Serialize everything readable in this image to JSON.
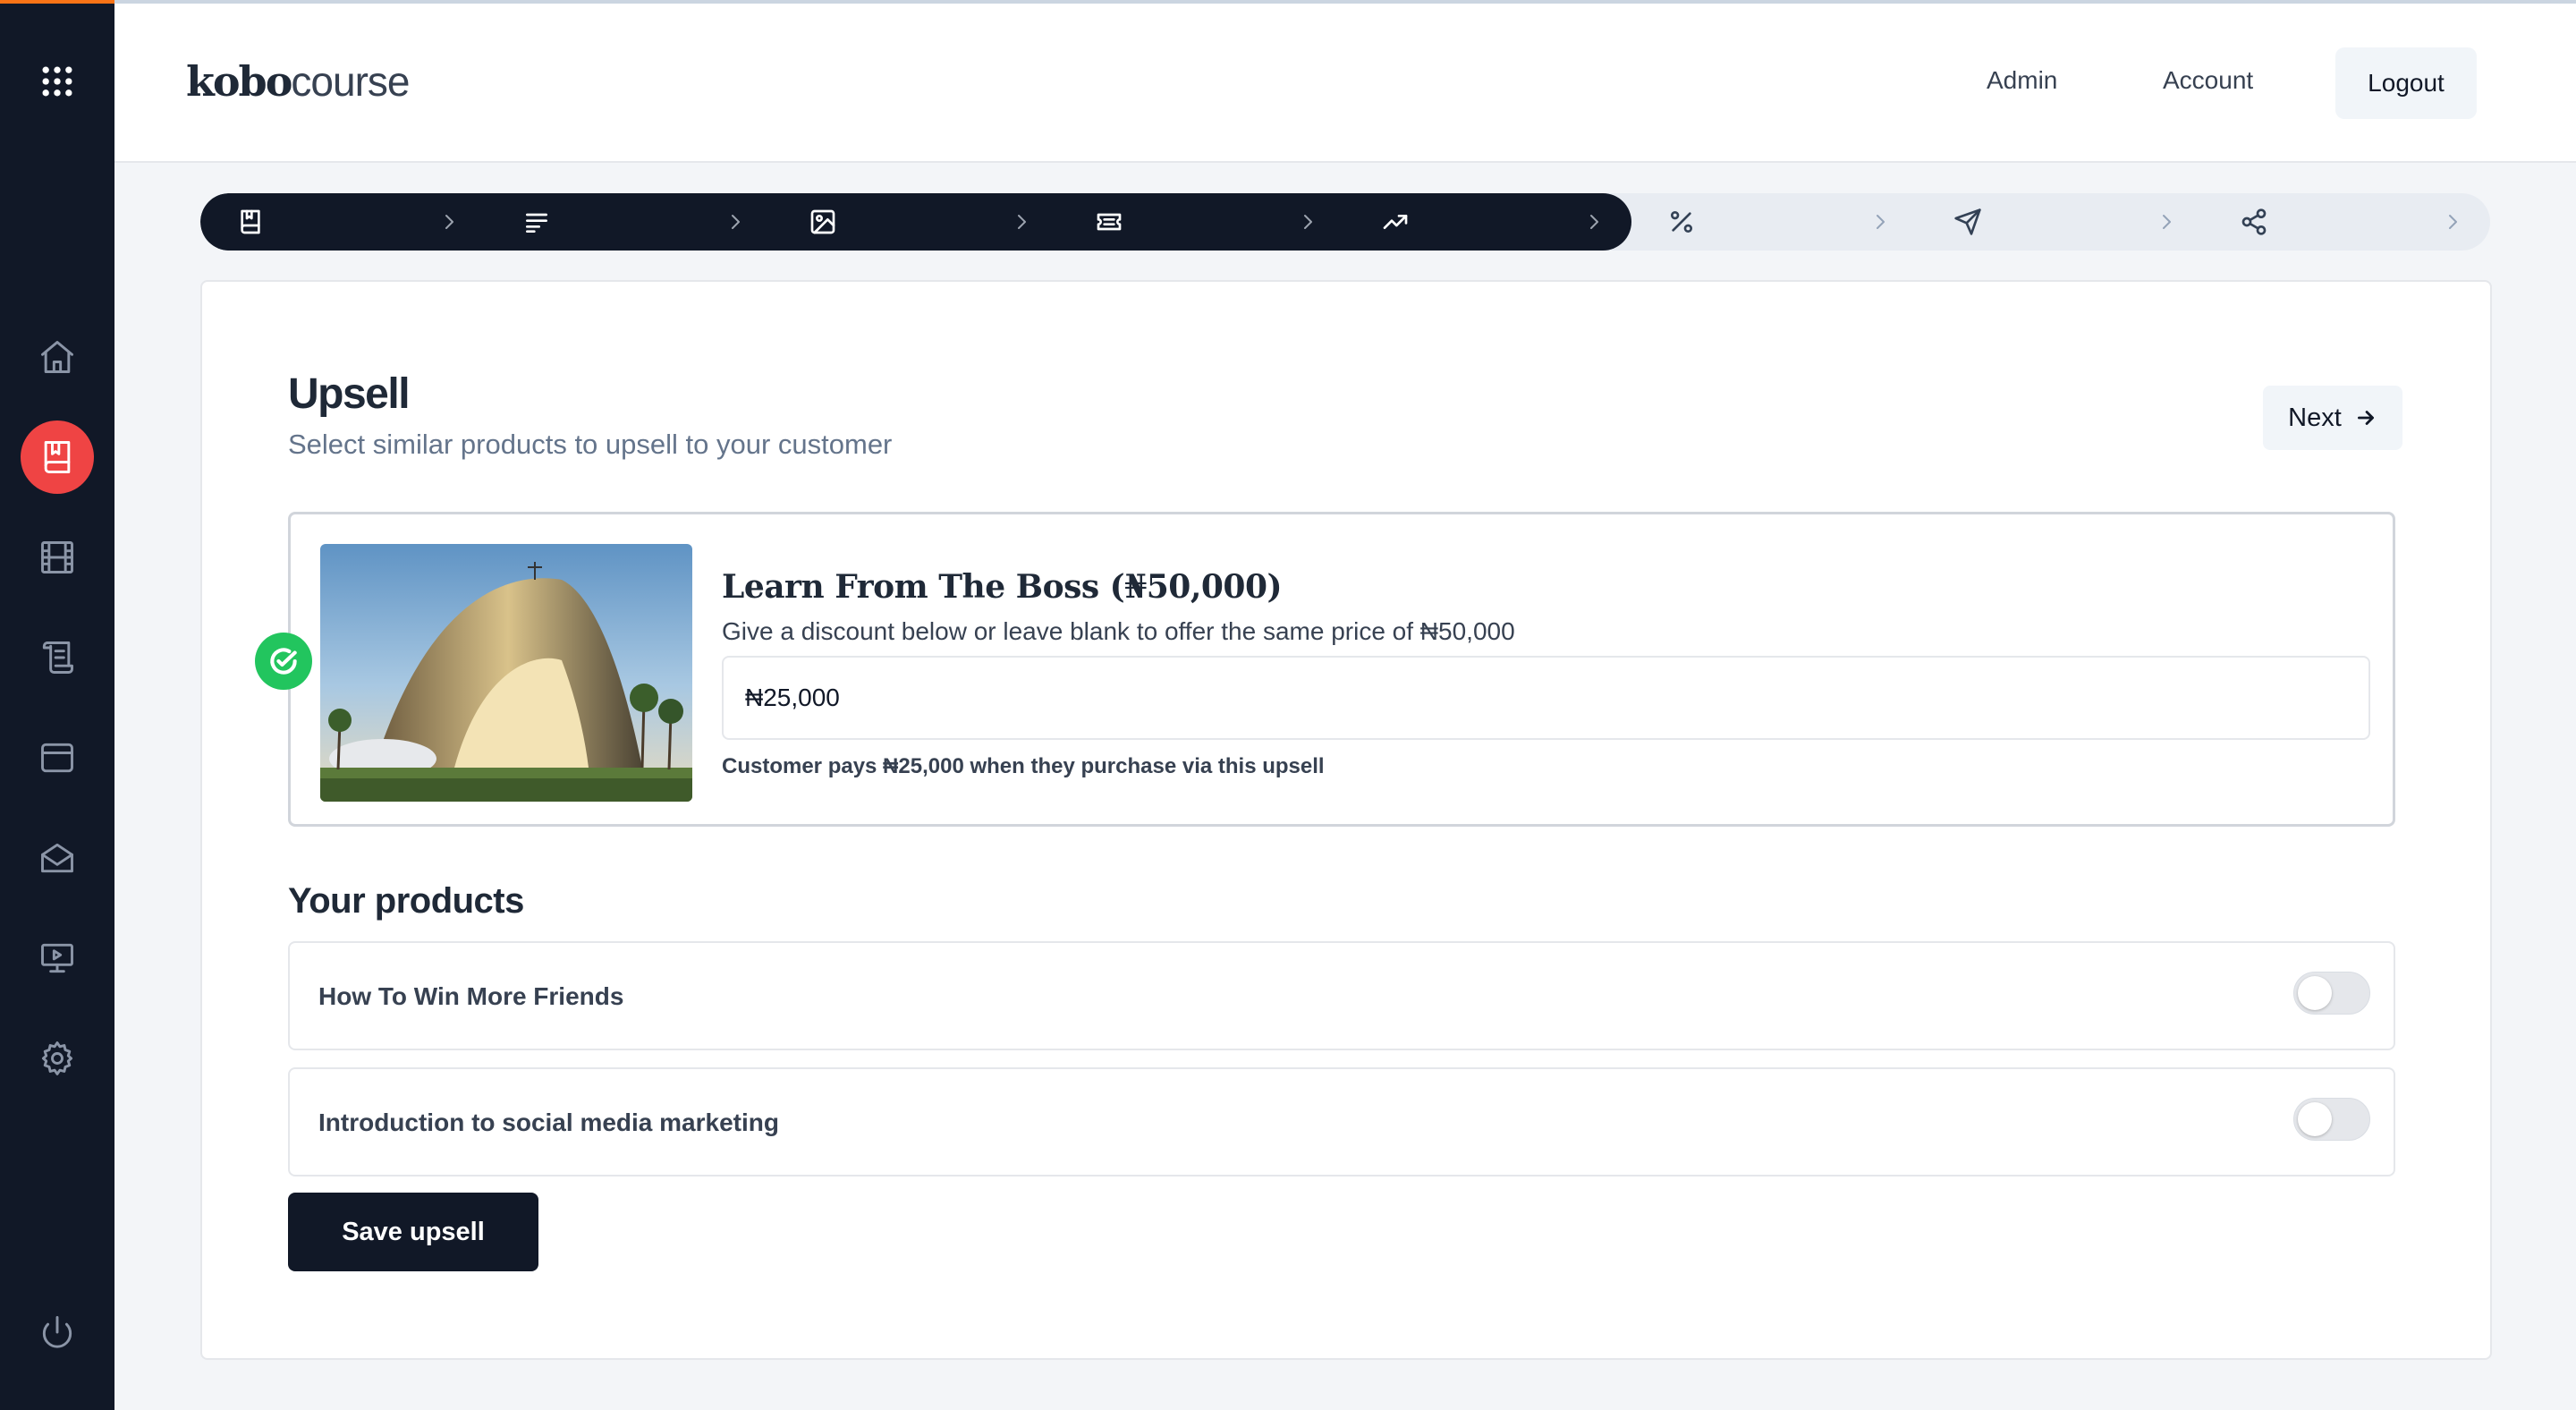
{
  "header": {
    "logo_bold": "kobo",
    "logo_light": "course",
    "nav": [
      {
        "label": "Admin"
      },
      {
        "label": "Account"
      }
    ],
    "logout_label": "Logout"
  },
  "sidebar": {
    "items": [
      {
        "icon": "apps-grid-icon"
      },
      {
        "icon": "home-icon"
      },
      {
        "icon": "book-icon",
        "active": true
      },
      {
        "icon": "film-icon"
      },
      {
        "icon": "scroll-icon"
      },
      {
        "icon": "wallet-icon"
      },
      {
        "icon": "mail-icon"
      },
      {
        "icon": "presentation-icon"
      },
      {
        "icon": "gear-icon"
      },
      {
        "icon": "power-icon"
      }
    ]
  },
  "stepper": {
    "steps": [
      {
        "icon": "book-icon",
        "completed": true
      },
      {
        "icon": "text-align-icon",
        "completed": true
      },
      {
        "icon": "image-icon",
        "completed": true
      },
      {
        "icon": "ticket-icon",
        "completed": true
      },
      {
        "icon": "trending-up-icon",
        "completed": true
      },
      {
        "icon": "percent-icon",
        "completed": false
      },
      {
        "icon": "send-icon",
        "completed": false
      },
      {
        "icon": "share-icon",
        "completed": false
      }
    ]
  },
  "main": {
    "title": "Upsell",
    "subtitle": "Select similar products to upsell to your customer",
    "next_label": "Next",
    "selected_product": {
      "title": "Learn From The Boss (₦50,000)",
      "description": "Give a discount below or leave blank to offer the same price of ₦50,000",
      "discount_value": "₦25,000",
      "note": "Customer pays ₦25,000 when they purchase via this upsell"
    },
    "products_heading": "Your products",
    "products": [
      {
        "name": "How To Win More Friends",
        "enabled": false
      },
      {
        "name": "Introduction to social media marketing",
        "enabled": false
      }
    ],
    "save_label": "Save upsell"
  },
  "colors": {
    "sidebar_bg": "#111827",
    "active_accent": "#ef4444",
    "success": "#22c55e",
    "primary_button": "#111827"
  }
}
